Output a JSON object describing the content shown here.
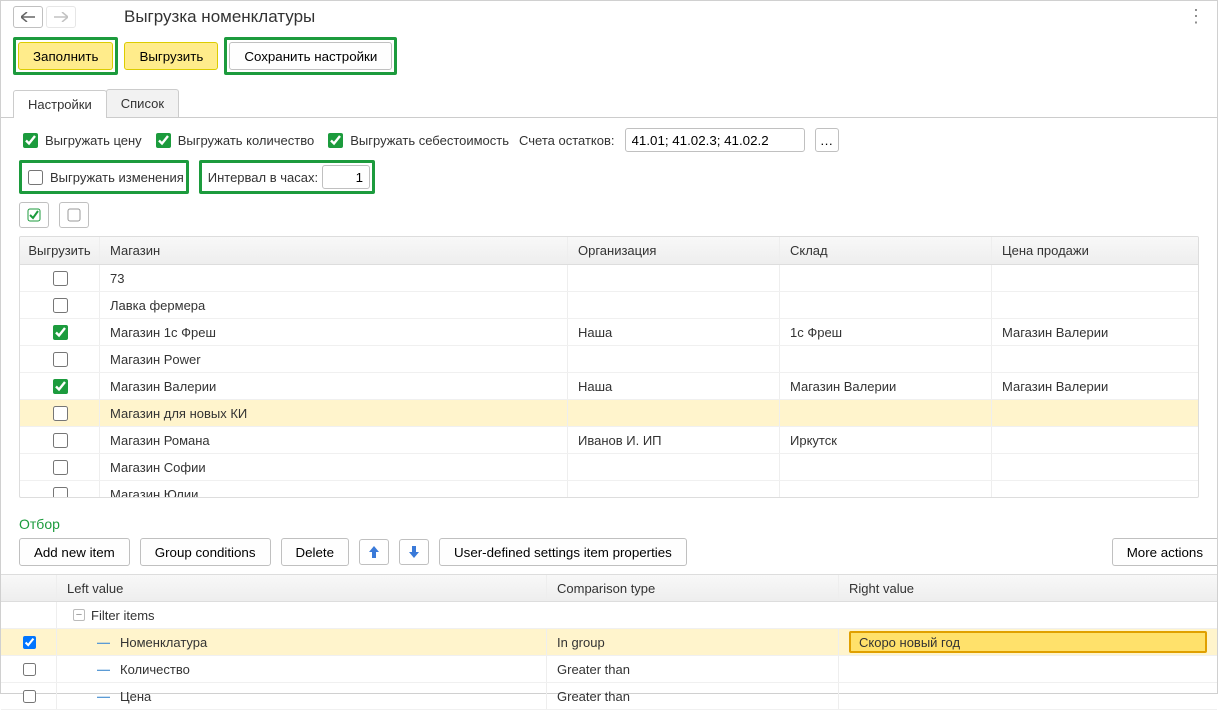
{
  "header": {
    "title": "Выгрузка номенклатуры"
  },
  "toolbar": {
    "fill": "Заполнить",
    "export": "Выгрузить",
    "save_settings": "Сохранить настройки"
  },
  "tabs": {
    "settings": "Настройки",
    "list": "Список"
  },
  "settings": {
    "export_price_label": "Выгружать цену",
    "export_qty_label": "Выгружать количество",
    "export_cost_label": "Выгружать себестоимость",
    "balance_accounts_label": "Счета остатков:",
    "balance_accounts_value": "41.01; 41.02.3; 41.02.2",
    "export_changes_label": "Выгружать изменения",
    "interval_label": "Интервал в часах:",
    "interval_value": "1"
  },
  "shops_table": {
    "headers": {
      "export": "Выгрузить",
      "shop": "Магазин",
      "org": "Организация",
      "warehouse": "Склад",
      "price": "Цена продажи"
    },
    "rows": [
      {
        "checked": false,
        "shop": "73",
        "org": "",
        "wh": "",
        "price": ""
      },
      {
        "checked": false,
        "shop": "Лавка фермера",
        "org": "",
        "wh": "",
        "price": ""
      },
      {
        "checked": true,
        "shop": "Магазин 1с Фреш",
        "org": "Наша",
        "wh": "1с Фреш",
        "price": "Магазин Валерии"
      },
      {
        "checked": false,
        "shop": "Магазин Power",
        "org": "",
        "wh": "",
        "price": ""
      },
      {
        "checked": true,
        "shop": "Магазин Валерии",
        "org": "Наша",
        "wh": "Магазин Валерии",
        "price": "Магазин Валерии"
      },
      {
        "checked": false,
        "shop": "Магазин для новых КИ",
        "org": "",
        "wh": "",
        "price": "",
        "selected": true
      },
      {
        "checked": false,
        "shop": "Магазин Романа",
        "org": "Иванов И. ИП",
        "wh": "Иркутск",
        "price": ""
      },
      {
        "checked": false,
        "shop": "Магазин Софии",
        "org": "",
        "wh": "",
        "price": ""
      },
      {
        "checked": false,
        "shop": "Магазин Юлии",
        "org": "",
        "wh": "",
        "price": ""
      }
    ]
  },
  "filter": {
    "section_title": "Отбор",
    "add_item": "Add new item",
    "group_conditions": "Group conditions",
    "delete": "Delete",
    "user_props": "User-defined settings item properties",
    "more_actions": "More actions",
    "headers": {
      "left": "Left value",
      "comparison": "Comparison type",
      "right": "Right value"
    },
    "group_label": "Filter items",
    "rows": [
      {
        "checked": true,
        "left": "Номенклатура",
        "cmp": "In group",
        "right": "Скоро новый год",
        "selected": true
      },
      {
        "checked": false,
        "left": "Количество",
        "cmp": "Greater than",
        "right": ""
      },
      {
        "checked": false,
        "left": "Цена",
        "cmp": "Greater than",
        "right": ""
      }
    ]
  }
}
